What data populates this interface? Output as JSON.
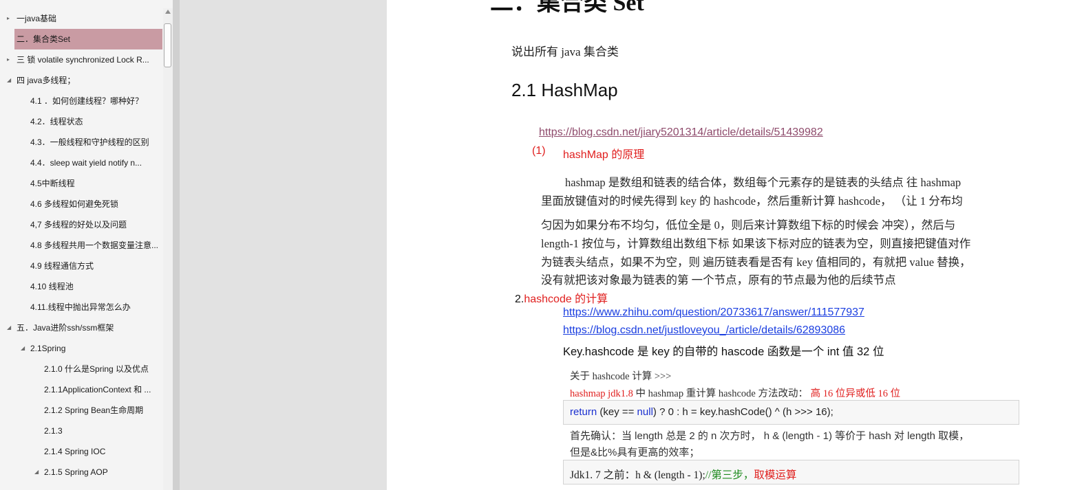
{
  "nav": {
    "items": [
      {
        "label": "一java基础",
        "toggle": "▸"
      },
      {
        "label": "二．集合类Set",
        "toggle": "▸",
        "selected": true
      },
      {
        "label": "三 锁 volatile synchronized Lock R...",
        "toggle": "▸"
      },
      {
        "label": "四 java多线程；",
        "toggle": "◢"
      },
      {
        "label": "4.1 ．如何创建线程？哪种好？",
        "toggle": ""
      },
      {
        "label": "4.2．线程状态",
        "toggle": ""
      },
      {
        "label": "4.3．一般线程和守护线程的区别",
        "toggle": ""
      },
      {
        "label": "4.4．sleep  wait  yield notify n...",
        "toggle": ""
      },
      {
        "label": "4.5中断线程",
        "toggle": ""
      },
      {
        "label": "4.6 多线程如何避免死锁",
        "toggle": ""
      },
      {
        "label": "4,7 多线程的好处以及问题",
        "toggle": ""
      },
      {
        "label": "4.8 多线程共用一个数据变量注意...",
        "toggle": ""
      },
      {
        "label": "4.9 线程通信方式",
        "toggle": ""
      },
      {
        "label": "4.10  线程池",
        "toggle": ""
      },
      {
        "label": "4.11.线程中抛出异常怎么办",
        "toggle": ""
      },
      {
        "label": "五．Java进阶ssh/ssm框架",
        "toggle": "◢"
      },
      {
        "label": "2.1Spring",
        "toggle": "◢"
      },
      {
        "label": "2.1.0 什么是Spring 以及优点",
        "toggle": ""
      },
      {
        "label": "2.1.1ApplicationContext 和 ...",
        "toggle": ""
      },
      {
        "label": "2.1.2 Spring Bean生命周期",
        "toggle": ""
      },
      {
        "label": "2.1.3",
        "toggle": ""
      },
      {
        "label": "2.1.4 Spring IOC",
        "toggle": ""
      },
      {
        "label": "2.1.5 Spring AOP",
        "toggle": "◢"
      }
    ]
  },
  "doc": {
    "heading": "二．集合类 Set",
    "intro": "说出所有 java 集合类",
    "subheading": "2.1 HashMap",
    "link1": "https://blog.csdn.net/jiary5201314/article/details/51439982",
    "p1_num": "(1)",
    "p1_title": "hashMap 的原理",
    "para": [
      "hashmap 是数组和链表的结合体，数组每个元素存的是链表的头结点 往 hashmap",
      "里面放键值对的时候先得到 key 的 hashcode，然后重新计算 hashcode，  （让 1 分布均",
      "匀因为如果分布不均匀，低位全是 0，则后来计算数组下标的时候会 冲突），然后与",
      "length-1 按位与，计算数组出数组下标 如果该下标对应的链表为空，则直接把键值对作",
      "为链表头结点，如果不为空，则 遍历链表看是否有 key 值相同的，有就把 value 替换，",
      "没有就把该对象最为链表的第 一个节点，原有的节点最为他的后续节点"
    ],
    "p2_num": "2.",
    "p2_title": "hashcode 的计算",
    "link2": "https://www.zhihu.com/question/20733617/answer/111577937",
    "link3": "https://blog.csdn.net/justloveyou_/article/details/62893086",
    "keyline": "Key.hashcode 是 key 的自带的 hascode 函数是一个 int 值 32 位",
    "about": "关于 hashcode 计算    >>>",
    "jdk_a": "hashmap jdk1.8",
    "jdk_b": " 中 hashmap 重计算 hashcode 方法改动：",
    "jdk_c": "  高 16 位异或低 16 位",
    "code1_kw1": "return",
    "code1_a": " (key == ",
    "code1_kw2": "null",
    "code1_b": ") ? 0 : h = key.hashCode() ^ (h >>> 16);",
    "confirm1": "首先确认：当 length 总是 2 的 n 次方时，  h & (length - 1)    等价于    hash 对 length 取模，",
    "confirm2": "但是&比%具有更高的效率；",
    "code2_a": "Jdk1. 7 之前：h & (length - 1);",
    "code2_b": "//第三步，",
    "code2_c": "取模运算"
  }
}
